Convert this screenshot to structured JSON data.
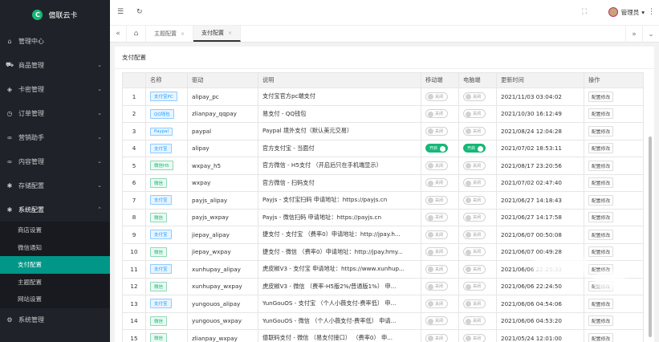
{
  "brand": {
    "name": "億联云卡",
    "mark": "C"
  },
  "sidebar": {
    "items": [
      {
        "icon": "home",
        "label": "管理中心",
        "arrow": ""
      },
      {
        "icon": "cart",
        "label": "商品管理",
        "arrow": "⌄"
      },
      {
        "icon": "layers",
        "label": "卡密管理",
        "arrow": "⌄"
      },
      {
        "icon": "clock",
        "label": "订单管理",
        "arrow": "⌄"
      },
      {
        "icon": "link",
        "label": "营销助手",
        "arrow": "⌄"
      },
      {
        "icon": "link",
        "label": "内容管理",
        "arrow": "⌄"
      },
      {
        "icon": "gear",
        "label": "存储配置",
        "arrow": "⌄"
      }
    ],
    "open_section": {
      "label": "系统配置",
      "arrow": "⌃"
    },
    "sub_items": [
      "商店设置",
      "微信通知",
      "支付配置",
      "主题配置",
      "网站设置"
    ],
    "active_sub": "支付配置",
    "bottom_item": "系统管理"
  },
  "header": {
    "user_name": "管理员",
    "user_arrow": "▾"
  },
  "tabs": {
    "items": [
      {
        "label": "主题配置",
        "close": "×"
      },
      {
        "label": "支付配置",
        "close": "×"
      }
    ],
    "active": 1
  },
  "card": {
    "title": "支付配置",
    "columns": [
      "",
      "名称",
      "驱动",
      "说明",
      "移动端",
      "电脑端",
      "更新时间",
      "操作"
    ],
    "switch_on": "开启",
    "switch_off": "关闭",
    "op_label": "配置修改",
    "rows": [
      {
        "id": "1",
        "name": "支付宝PC",
        "color": "blue",
        "driver": "alipay_pc",
        "desc": "支付宝官方pc端支付",
        "mobile": false,
        "pc": false,
        "time": "2021/11/03 03:04:02"
      },
      {
        "id": "2",
        "name": "QQ钱包",
        "color": "blue",
        "driver": "zlianpay_qqpay",
        "desc": "易支付 - QQ钱包",
        "mobile": false,
        "pc": false,
        "time": "2021/10/30 16:12:49"
      },
      {
        "id": "3",
        "name": "Paypal",
        "color": "blue",
        "driver": "paypal",
        "desc": "Paypal 境外支付（默认美元交易）",
        "mobile": false,
        "pc": false,
        "time": "2021/08/24 12:04:28"
      },
      {
        "id": "4",
        "name": "支付宝",
        "color": "blue",
        "driver": "alipay",
        "desc": "官方支付宝 - 当面付",
        "mobile": true,
        "pc": true,
        "time": "2021/07/02 18:53:11"
      },
      {
        "id": "5",
        "name": "微信H5",
        "color": "green",
        "driver": "wxpay_h5",
        "desc": "官方微信 - H5支付 （开启后只在手机端显示）",
        "mobile": false,
        "pc": false,
        "time": "2021/08/17 23:20:56"
      },
      {
        "id": "6",
        "name": "微信",
        "color": "green",
        "driver": "wxpay",
        "desc": "官方微信 - 扫码支付",
        "mobile": false,
        "pc": false,
        "time": "2021/07/02 02:47:40"
      },
      {
        "id": "7",
        "name": "支付宝",
        "color": "blue",
        "driver": "payjs_alipay",
        "desc": "Payjs - 支付宝扫码 申请地址：https://payjs.cn",
        "mobile": false,
        "pc": false,
        "time": "2021/06/27 14:18:43"
      },
      {
        "id": "8",
        "name": "微信",
        "color": "green",
        "driver": "payjs_wxpay",
        "desc": "Payjs - 微信扫码 申请地址：https://payjs.cn",
        "mobile": false,
        "pc": false,
        "time": "2021/06/27 14:17:58"
      },
      {
        "id": "9",
        "name": "支付宝",
        "color": "blue",
        "driver": "jiepay_alipay",
        "desc": "捷支付 - 支付宝 （费率0）申请地址：http://jpay.h...",
        "mobile": false,
        "pc": false,
        "time": "2021/06/07 00:50:08"
      },
      {
        "id": "10",
        "name": "微信",
        "color": "green",
        "driver": "jiepay_wxpay",
        "desc": "捷支付 - 微信 （费率0）申请地址：http://jpay.hmy...",
        "mobile": false,
        "pc": false,
        "time": "2021/06/07 00:49:28"
      },
      {
        "id": "11",
        "name": "支付宝",
        "color": "blue",
        "driver": "xunhupay_alipay",
        "desc": "虎皮椒V3 - 支付宝 申请地址：https://www.xunhup...",
        "mobile": false,
        "pc": false,
        "time": "2021/06/06 22:25:33"
      },
      {
        "id": "12",
        "name": "微信",
        "color": "green",
        "driver": "xunhupay_wxpay",
        "desc": "虎皮椒V3 - 微信 （费率-H5版2%/普通版1%） 申...",
        "mobile": false,
        "pc": false,
        "time": "2021/06/06 22:24:50"
      },
      {
        "id": "13",
        "name": "支付宝",
        "color": "blue",
        "driver": "yungouos_alipay",
        "desc": "YunGouOS - 支付宝 （个人小薇支付-费率低） 申...",
        "mobile": false,
        "pc": false,
        "time": "2021/06/06 04:54:06"
      },
      {
        "id": "14",
        "name": "微信",
        "color": "green",
        "driver": "yungouos_wxpay",
        "desc": "YunGouOS - 微信 （个人小薇支付-费率低） 申请...",
        "mobile": false,
        "pc": false,
        "time": "2021/06/06 04:53:20"
      },
      {
        "id": "15",
        "name": "微信",
        "color": "green",
        "driver": "zlianpay_wxpay",
        "desc": "億联码支付 - 微信 （易支付接口） （费率0） 申...",
        "mobile": false,
        "pc": false,
        "time": "2021/05/24 12:01:00"
      }
    ]
  },
  "colors": {
    "sidebar_bg": "#20222a",
    "accent": "#009688",
    "switch_on": "#16b777"
  }
}
